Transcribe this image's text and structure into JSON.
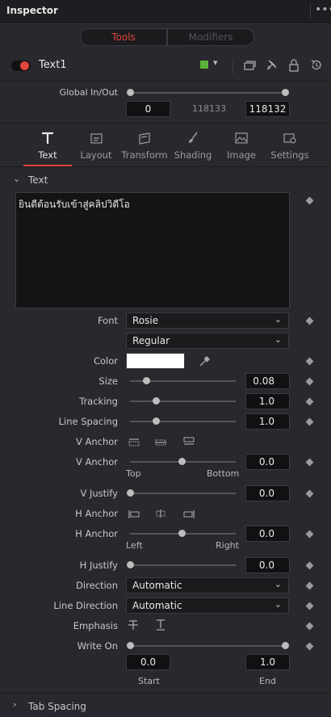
{
  "panel": {
    "title": "Inspector",
    "menu_icon": "more-icon"
  },
  "top_tabs": {
    "tools": "Tools",
    "modifiers": "Modifiers"
  },
  "node": {
    "name": "Text1",
    "color_chip": "#5db33a",
    "accent": "#e0453e"
  },
  "global_inout": {
    "label": "Global In/Out",
    "in": "0",
    "duration": "118133",
    "out": "118132"
  },
  "tabs": [
    {
      "label": "Text",
      "icon": "text-icon"
    },
    {
      "label": "Layout",
      "icon": "layout-icon"
    },
    {
      "label": "Transform",
      "icon": "transform-icon"
    },
    {
      "label": "Shading",
      "icon": "shading-brush-icon"
    },
    {
      "label": "Image",
      "icon": "image-icon"
    },
    {
      "label": "Settings",
      "icon": "settings-icon"
    }
  ],
  "text_section": {
    "title": "Text",
    "styled_text": "ยินดีต้อนรับเข้าสู่คลิปวิดีโอ"
  },
  "font": {
    "label": "Font",
    "family": "Rosie",
    "style": "Regular"
  },
  "color": {
    "label": "Color",
    "value": "#ffffff"
  },
  "size": {
    "label": "Size",
    "value": "0.08",
    "fraction": 0.08
  },
  "tracking": {
    "label": "Tracking",
    "value": "1.0"
  },
  "line_spacing": {
    "label": "Line Spacing",
    "value": "1.0"
  },
  "v_anchor_buttons": {
    "label": "V Anchor"
  },
  "v_anchor": {
    "label": "V Anchor",
    "value": "0.0",
    "min_label": "Top",
    "max_label": "Bottom"
  },
  "v_justify": {
    "label": "V Justify",
    "value": "0.0"
  },
  "h_anchor_buttons": {
    "label": "H Anchor"
  },
  "h_anchor": {
    "label": "H Anchor",
    "value": "0.0",
    "min_label": "Left",
    "max_label": "Right"
  },
  "h_justify": {
    "label": "H Justify",
    "value": "0.0"
  },
  "direction": {
    "label": "Direction",
    "value": "Automatic"
  },
  "line_direction": {
    "label": "Line Direction",
    "value": "Automatic"
  },
  "emphasis": {
    "label": "Emphasis"
  },
  "write_on": {
    "label": "Write On",
    "start": "0.0",
    "end": "1.0",
    "start_label": "Start",
    "end_label": "End"
  },
  "tab_spacing": {
    "title": "Tab Spacing"
  }
}
